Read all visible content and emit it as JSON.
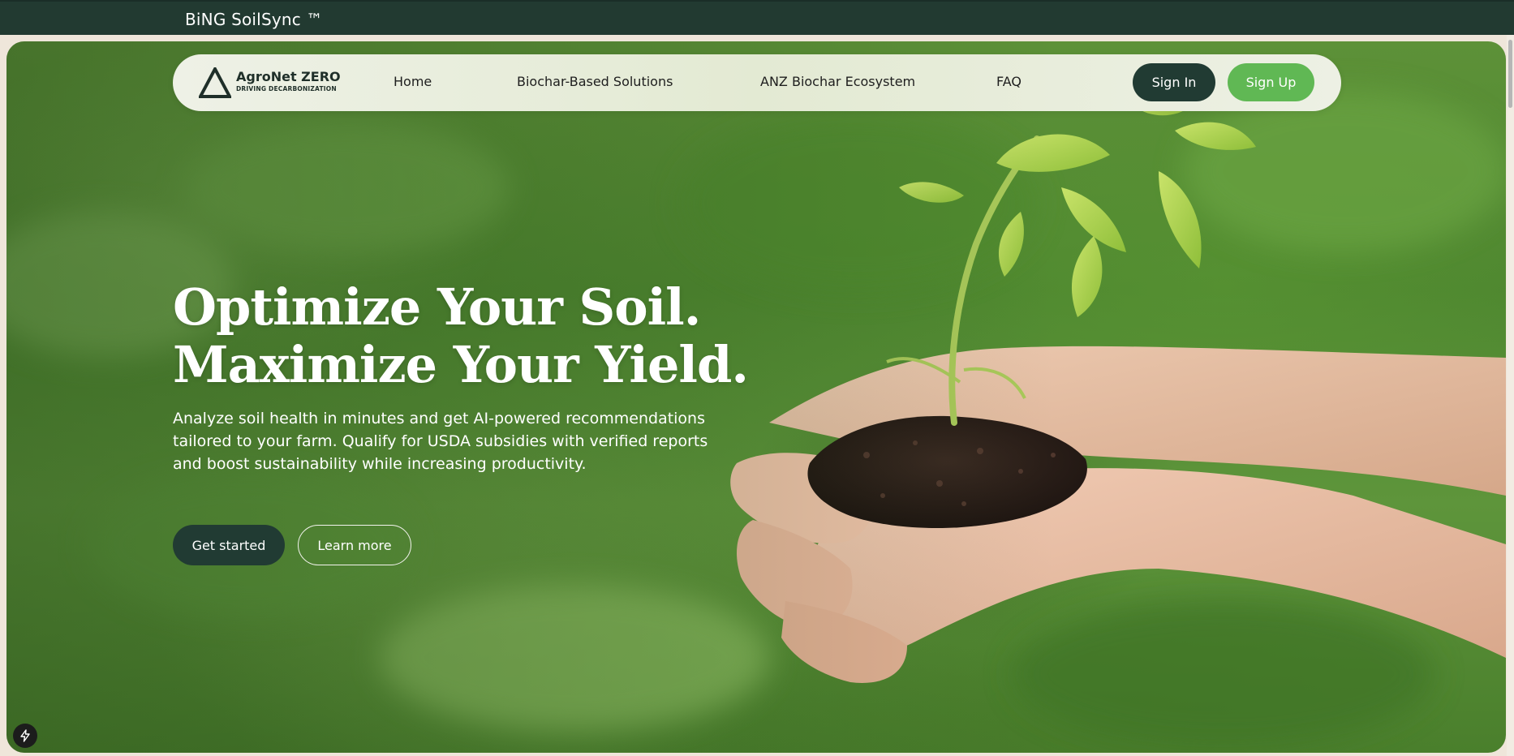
{
  "top_bar": {
    "brand": "BiNG SoilSync ™"
  },
  "nav": {
    "logo_name": "AgroNet ZERO",
    "logo_tagline": "DRIVING DECARBONIZATION",
    "links": [
      "Home",
      "Biochar-Based Solutions",
      "ANZ Biochar Ecosystem",
      "FAQ"
    ],
    "sign_in": "Sign In",
    "sign_up": "Sign Up"
  },
  "hero": {
    "headline_line1": "Optimize Your Soil.",
    "headline_line2": "Maximize Your Yield.",
    "description": "Analyze soil health in minutes and get AI-powered recommendations tailored to your farm. Qualify for USDA subsidies with verified reports and boost sustainability while increasing productivity.",
    "cta_primary": "Get started",
    "cta_secondary": "Learn more"
  },
  "colors": {
    "dark_green": "#213b33",
    "accent_green": "#60b854",
    "top_bar": "#223a31",
    "page_bg": "#efe6da"
  },
  "icons": {
    "logo": "triangle-logo-icon",
    "dev_badge": "lightning-bolt-icon"
  }
}
